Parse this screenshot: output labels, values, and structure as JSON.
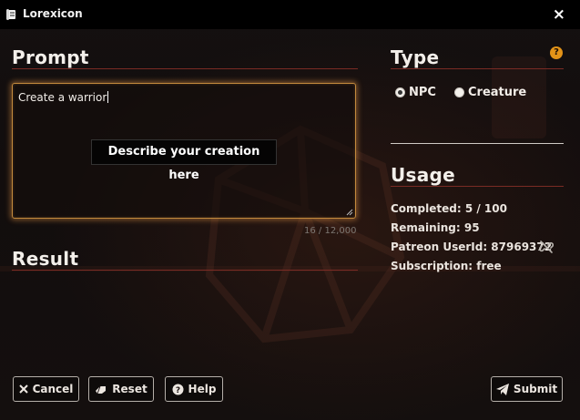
{
  "window": {
    "title": "Lorexicon",
    "close_glyph": "×"
  },
  "prompt": {
    "heading": "Prompt",
    "value": "Create a warrior",
    "tooltip": "Describe your creation here",
    "char_count": "16 / 12,000"
  },
  "result": {
    "heading": "Result"
  },
  "type": {
    "heading": "Type",
    "help_glyph": "?",
    "options": [
      {
        "label": "NPC",
        "selected": true
      },
      {
        "label": "Creature",
        "selected": false
      }
    ]
  },
  "usage": {
    "heading": "Usage",
    "completed": "Completed: 5 / 100",
    "remaining": "Remaining: 95",
    "patreon": "Patreon UserId: 87969372",
    "subscription": "Subscription: free"
  },
  "buttons": {
    "cancel": "Cancel",
    "reset": "Reset",
    "help": "Help",
    "submit": "Submit"
  },
  "colors": {
    "accent_rule": "#7a2b24",
    "focus_glow": "#c38a3d",
    "help_badge": "#e39318"
  },
  "icons": [
    "scroll-icon",
    "close-icon",
    "help-badge-icon",
    "unlink-icon",
    "x-icon",
    "eraser-icon",
    "question-circle-icon",
    "paper-plane-icon"
  ]
}
